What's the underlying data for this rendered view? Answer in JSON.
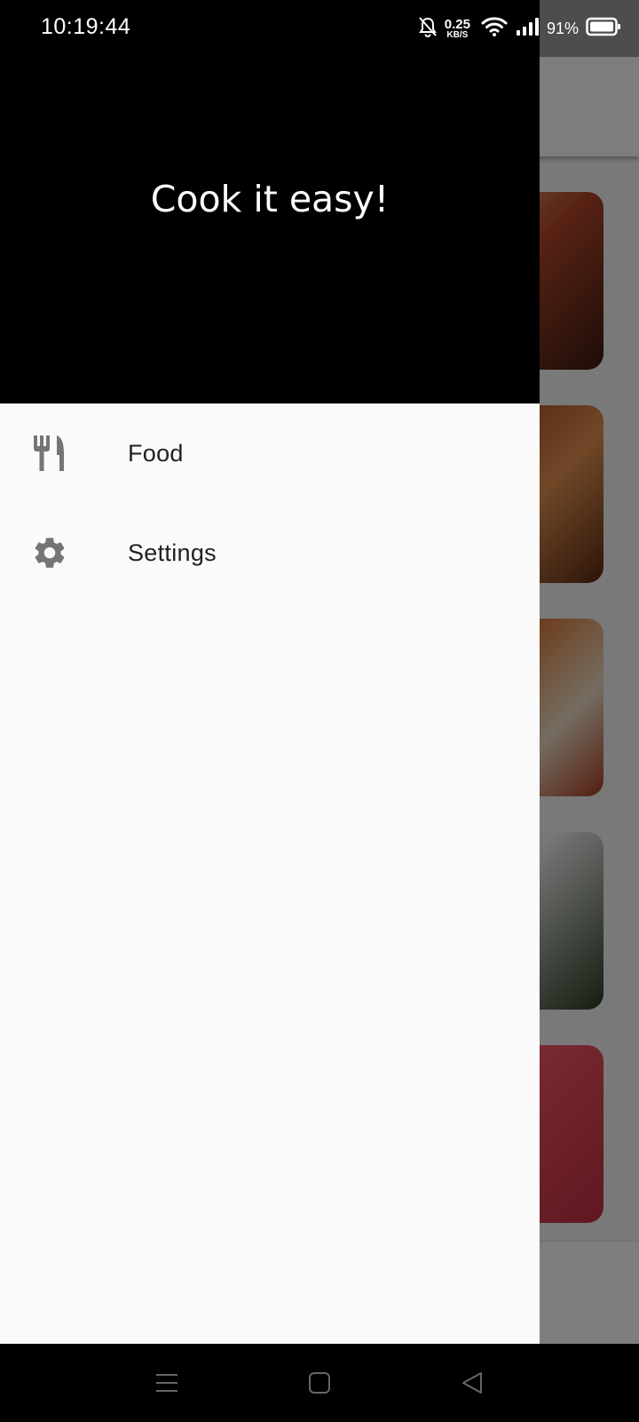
{
  "status_bar": {
    "time": "10:19:44",
    "net_speed_value": "0.25",
    "net_speed_unit": "KB/S",
    "battery_percent": "91%",
    "icons": [
      "bell-off-icon",
      "wifi-icon",
      "signal-icon",
      "battery-icon"
    ]
  },
  "drawer": {
    "title": "Cook it easy!",
    "items": [
      {
        "label": "Food",
        "icon": "fork-knife-icon"
      },
      {
        "label": "Settings",
        "icon": "gear-icon"
      }
    ]
  },
  "nav_bar": {
    "icons": [
      "menu-icon",
      "home-icon",
      "back-icon"
    ]
  },
  "colors": {
    "header_bg": "#000000",
    "drawer_bg": "#fafafa",
    "icon_gray": "#757575",
    "text_dark": "#212121"
  }
}
